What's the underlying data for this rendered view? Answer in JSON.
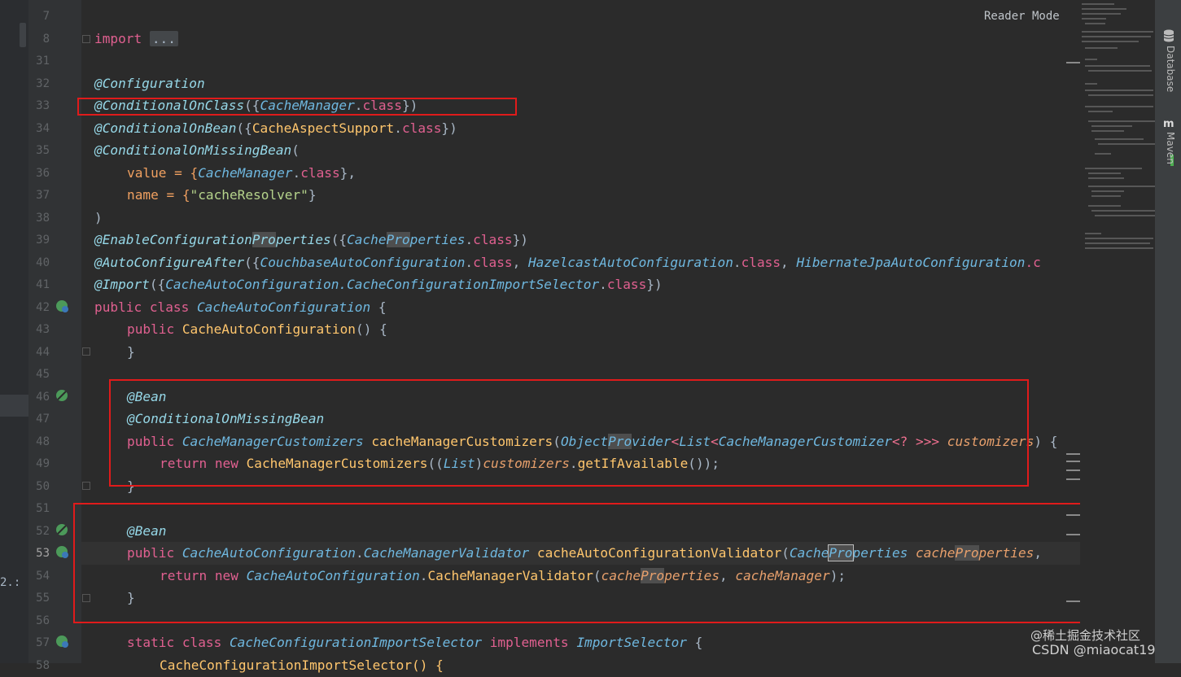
{
  "editor": {
    "reader_mode": "Reader Mode",
    "line_numbers": [
      "7",
      "8",
      "31",
      "32",
      "33",
      "34",
      "35",
      "36",
      "37",
      "38",
      "39",
      "40",
      "41",
      "42",
      "43",
      "44",
      "45",
      "46",
      "47",
      "48",
      "49",
      "50",
      "51",
      "52",
      "53",
      "54",
      "55",
      "56",
      "57",
      "58"
    ],
    "current_line": "53",
    "code": {
      "l8_kw": "import",
      "l8_fold": "...",
      "l32": "@Configuration",
      "l33_a": "@ConditionalOnClass",
      "l33_b": "({",
      "l33_c": "CacheManager",
      "l33_d": ".",
      "l33_e": "class",
      "l33_f": "})",
      "l34_a": "@ConditionalOnBean",
      "l34_b": "({",
      "l34_c": "CacheAspectSupport",
      "l34_d": ".",
      "l34_e": "class",
      "l34_f": "})",
      "l35_a": "@ConditionalOnMissingBean",
      "l35_b": "(",
      "l36_a": "value = {",
      "l36_b": "CacheManager",
      "l36_c": ".",
      "l36_d": "class",
      "l36_e": "},",
      "l37_a": "name = {",
      "l37_b": "\"cacheResolver\"",
      "l37_c": "}",
      "l38": ")",
      "l39_a": "@EnableConfiguration",
      "l39_b": "Pro",
      "l39_c": "perties",
      "l39_d": "({",
      "l39_e": "Cache",
      "l39_f": "Pro",
      "l39_g": "perties",
      "l39_h": ".",
      "l39_i": "class",
      "l39_j": "})",
      "l40_a": "@AutoConfigureAfter",
      "l40_b": "({",
      "l40_c": "CouchbaseAutoConfiguration",
      "l40_d": ".",
      "l40_e": "class",
      "l40_f": ", ",
      "l40_g": "HazelcastAutoConfiguration",
      "l40_h": ".",
      "l40_i": "class",
      "l40_j": ", ",
      "l40_k": "HibernateJpaAutoConfiguration",
      "l40_l": ".c",
      "l41_a": "@Import",
      "l41_b": "({",
      "l41_c": "CacheAutoConfiguration.CacheConfigurationImportSelector",
      "l41_d": ".",
      "l41_e": "class",
      "l41_f": "})",
      "l42_a": "public class ",
      "l42_b": "CacheAutoConfiguration",
      "l42_c": " {",
      "l43_a": "public ",
      "l43_b": "CacheAutoConfiguration",
      "l43_c": "() {",
      "l44": "}",
      "l46": "@Bean",
      "l47": "@ConditionalOnMissingBean",
      "l48_a": "public ",
      "l48_b": "CacheManagerCustomizers",
      "l48_c": " ",
      "l48_d": "cacheManagerCustomizers",
      "l48_e": "(",
      "l48_f": "Object",
      "l48_g": "Pro",
      "l48_h": "vider",
      "l48_i": "<",
      "l48_j": "List",
      "l48_k": "<",
      "l48_l": "CacheManagerCustomizer",
      "l48_m": "<? >>>",
      "l48_n": " customizers",
      "l48_o": ") {",
      "l49_a": "return new ",
      "l49_b": "CacheManagerCustomizers",
      "l49_c": "((",
      "l49_d": "List",
      "l49_e": ")",
      "l49_f": "customizers",
      "l49_g": ".",
      "l49_h": "getIfAvailable",
      "l49_i": "());",
      "l50": "}",
      "l52": "@Bean",
      "l53_a": "public ",
      "l53_b": "CacheAutoConfiguration",
      "l53_c": ".",
      "l53_d": "CacheManagerValidator",
      "l53_e": " ",
      "l53_f": "cacheAutoConfigurationValidator",
      "l53_g": "(",
      "l53_h": "Cache",
      "l53_i": "Pro",
      "l53_j": "perties",
      "l53_k": " cache",
      "l53_l": "Pro",
      "l53_m": "perties",
      "l53_n": ",",
      "l54_a": "return new ",
      "l54_b": "CacheAutoConfiguration",
      "l54_c": ".",
      "l54_d": "CacheManagerValidator",
      "l54_e": "(",
      "l54_f": "cache",
      "l54_g": "Pro",
      "l54_h": "perties",
      "l54_i": ", ",
      "l54_j": "cacheManager",
      "l54_k": ");",
      "l55": "}",
      "l57_a": "static class ",
      "l57_b": "CacheConfigurationImportSelector",
      "l57_c": " implements ",
      "l57_d": "ImportSelector",
      "l57_e": " {",
      "l58": "CacheConfigurationImportSelector() {"
    }
  },
  "left_fragment": "2.:",
  "right_sidebar": {
    "database": "Database",
    "maven": "Maven"
  },
  "watermark": {
    "juejin": "@稀土掘金技术社区",
    "csdn": "CSDN @miaocat19"
  },
  "colors": {
    "highlight_box": "#e01b1b",
    "background": "#2b2b2b"
  }
}
